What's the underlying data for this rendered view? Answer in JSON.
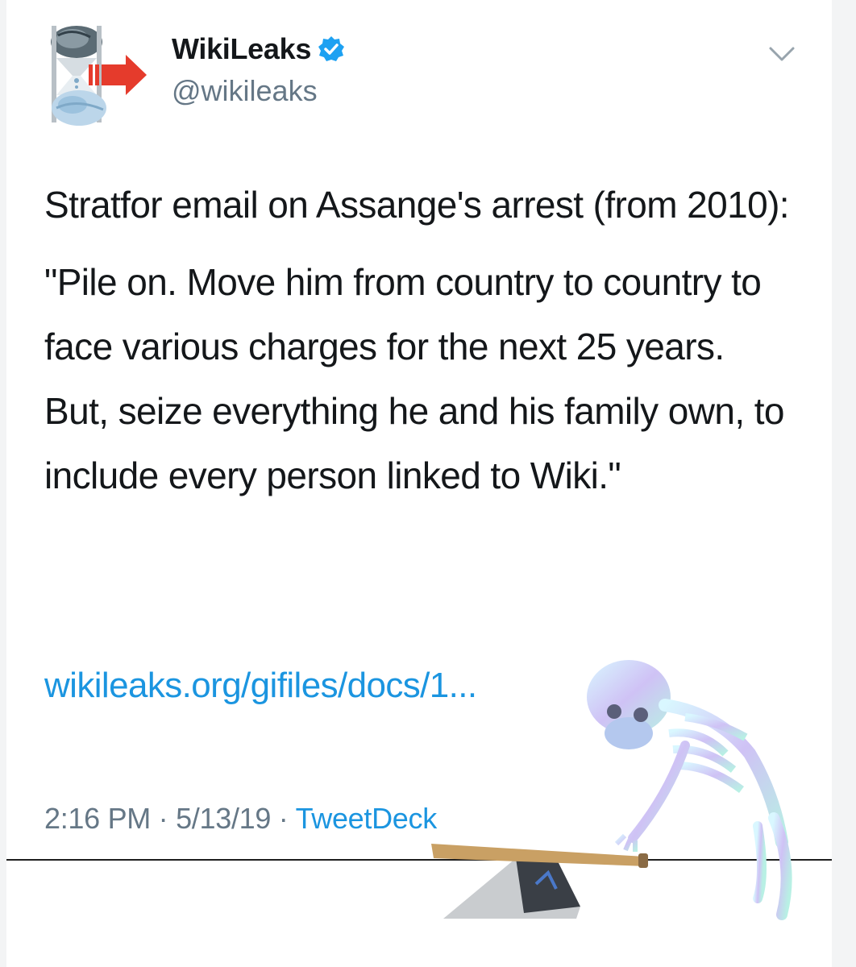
{
  "tweet": {
    "author": {
      "display_name": "WikiLeaks",
      "handle": "@wikileaks",
      "verified": true,
      "avatar_icon": "wikileaks-hourglass-logo-icon"
    },
    "text_paragraphs": [
      "Stratfor email on Assange's arrest (from 2010):",
      "\"Pile on. Move him from country to country to face various charges for the next 25 years. But, seize everything he and his family own, to include every person linked to Wiki.\""
    ],
    "link": "wikileaks.org/gifiles/docs/1...",
    "time": "2:16 PM",
    "date": "5/13/19",
    "source": "TweetDeck",
    "separator": "·"
  },
  "icons": {
    "verified": "verified-badge-icon",
    "menu": "chevron-down-icon",
    "arrow": "red-arrow-icon",
    "sticker": "skeleton-with-bat-sticker"
  },
  "colors": {
    "text": "#14171a",
    "muted": "#657786",
    "link": "#1b95e0",
    "verified": "#1da1f2",
    "arrow": "#e53b2c"
  }
}
